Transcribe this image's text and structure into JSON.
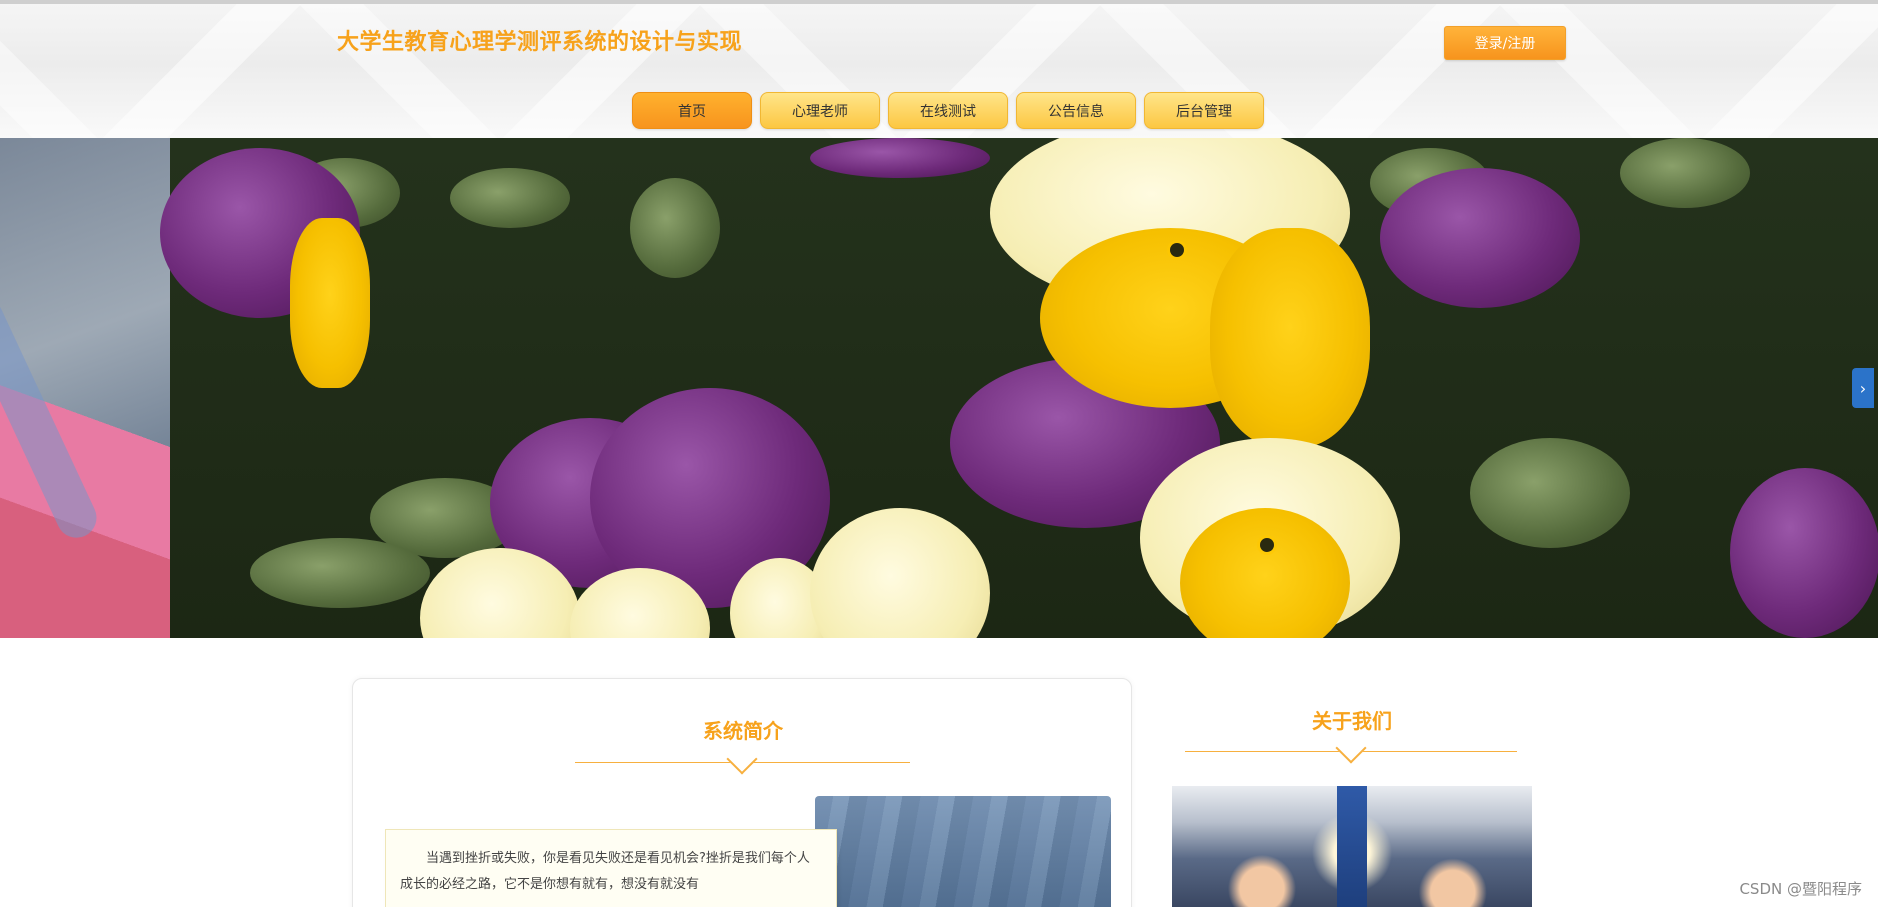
{
  "header": {
    "site_title": "大学生教育心理学测评系统的设计与实现",
    "login_label": "登录/注册"
  },
  "nav": {
    "items": [
      {
        "label": "首页",
        "active": true
      },
      {
        "label": "心理老师",
        "active": false
      },
      {
        "label": "在线测试",
        "active": false
      },
      {
        "label": "公告信息",
        "active": false
      },
      {
        "label": "后台管理",
        "active": false
      }
    ]
  },
  "banner": {
    "next_arrow": "›"
  },
  "intro": {
    "title": "系统简介",
    "text": "当遇到挫折或失败，你是看见失败还是看见机会?挫折是我们每个人成长的必经之路，它不是你想有就有，想没有就没有"
  },
  "about": {
    "title": "关于我们"
  },
  "watermark": "CSDN @暨阳程序",
  "colors": {
    "accent": "#f7a21b",
    "nav_active": "#f7941d",
    "nav_default": "#fcc742"
  }
}
